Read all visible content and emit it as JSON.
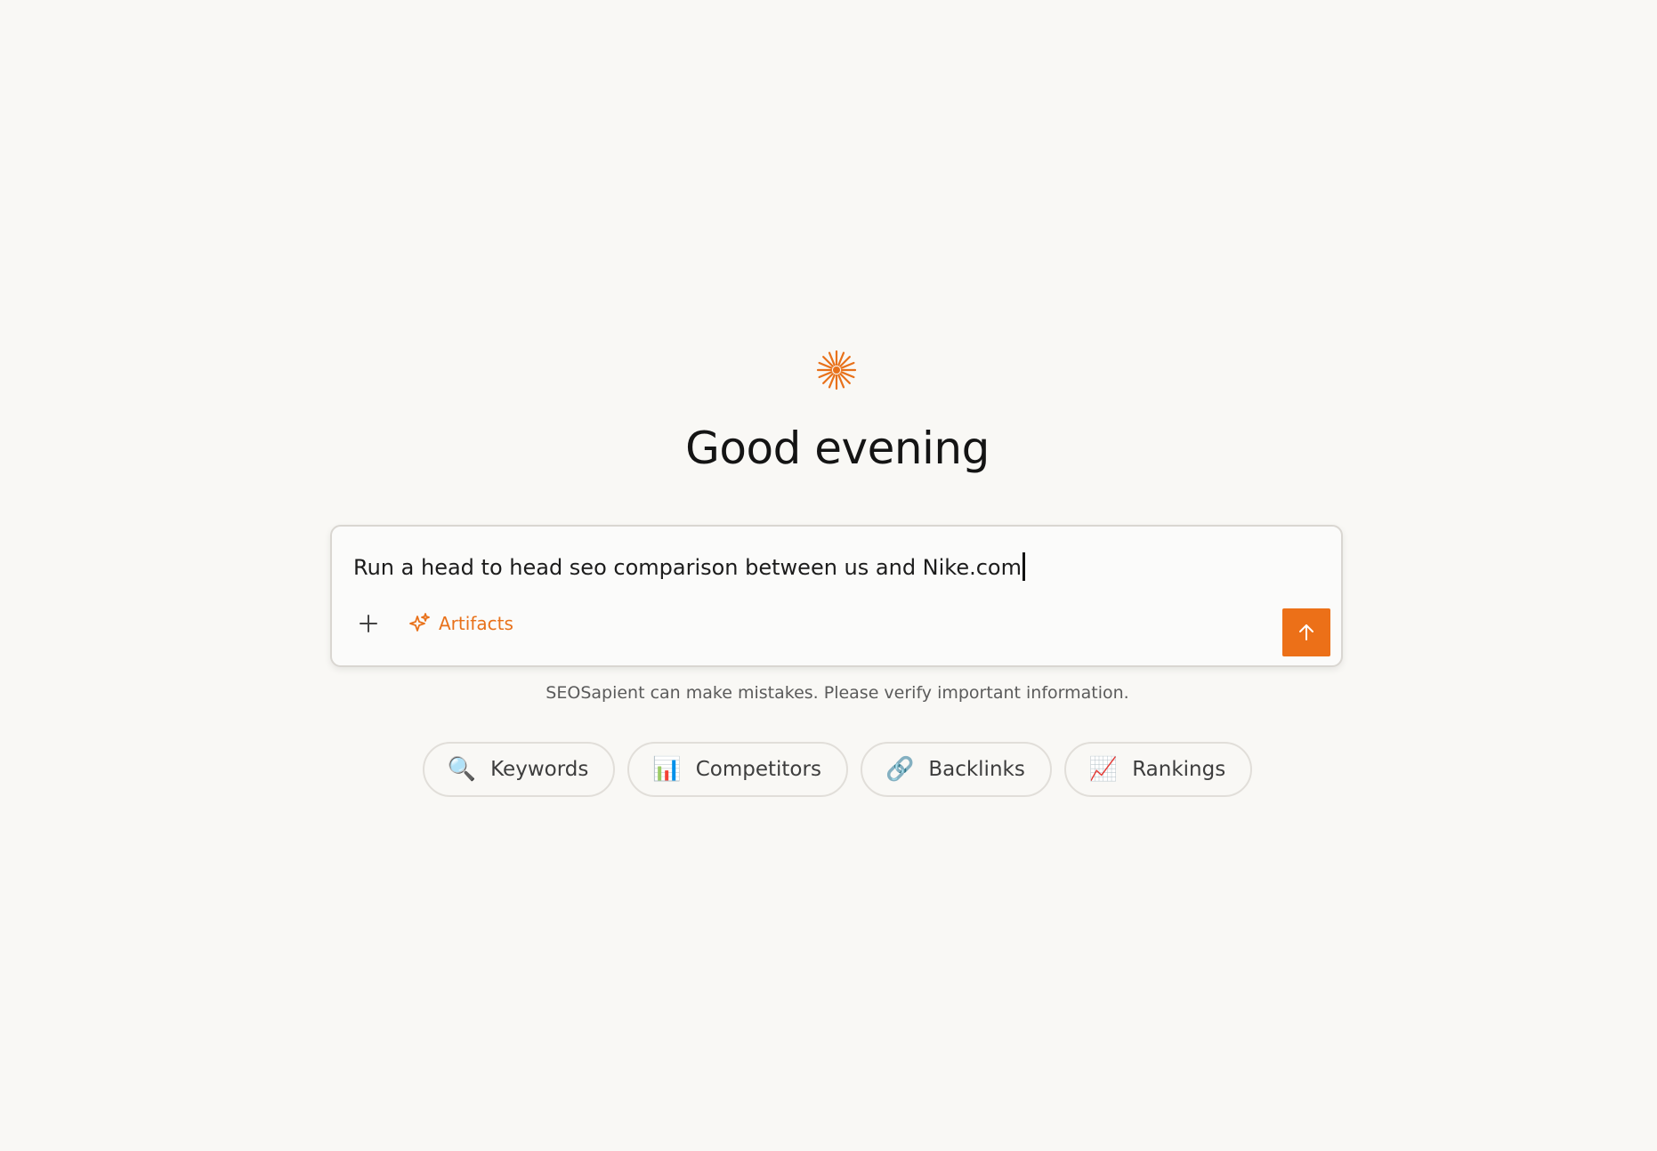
{
  "greeting": "Good evening",
  "composer": {
    "input_value": "Run a head to head seo comparison between us and Nike.com",
    "artifacts_label": "Artifacts",
    "send_icon": "arrow-up-icon",
    "attach_icon": "plus-icon"
  },
  "disclaimer": "SEOSapient can make mistakes. Please verify important information.",
  "chips": [
    {
      "icon": "🔍",
      "label": "Keywords"
    },
    {
      "icon": "📊",
      "label": "Competitors"
    },
    {
      "icon": "🔗",
      "label": "Backlinks"
    },
    {
      "icon": "📈",
      "label": "Rankings"
    }
  ],
  "colors": {
    "accent": "#ec7018",
    "background": "#f9f8f5"
  }
}
